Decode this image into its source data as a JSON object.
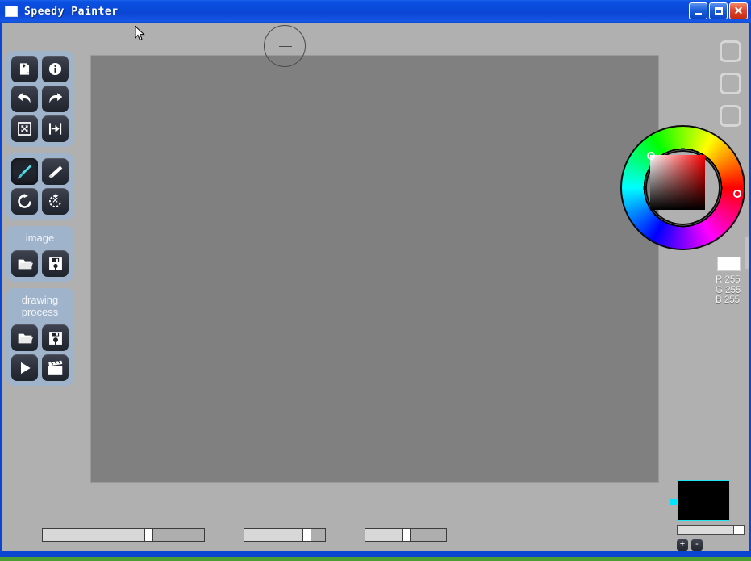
{
  "window": {
    "title": "Speedy Painter",
    "icon": "app-window-icon",
    "buttons": {
      "minimize": "_",
      "maximize": "□",
      "close": "✕"
    }
  },
  "toolbar": {
    "groups": [
      {
        "name": "file-and-view",
        "label": "",
        "buttons": [
          {
            "name": "new-image-button",
            "icon": "new-document-icon",
            "tooltip": "New image"
          },
          {
            "name": "info-button",
            "icon": "info-icon",
            "tooltip": "Info"
          },
          {
            "name": "undo-button",
            "icon": "undo-arrow-icon",
            "tooltip": "Undo"
          },
          {
            "name": "redo-button",
            "icon": "redo-arrow-icon",
            "tooltip": "Redo"
          },
          {
            "name": "fit-screen-button",
            "icon": "fit-to-screen-icon",
            "tooltip": "Fit to screen"
          },
          {
            "name": "fit-width-button",
            "icon": "fit-to-width-icon",
            "tooltip": "Fit width"
          }
        ]
      },
      {
        "name": "drawing-tools",
        "label": "",
        "buttons": [
          {
            "name": "brush-tool-button",
            "icon": "paintbrush-icon",
            "tooltip": "Brush",
            "active": true
          },
          {
            "name": "eraser-tool-button",
            "icon": "eraser-icon",
            "tooltip": "Eraser",
            "active": false
          },
          {
            "name": "rotate-button",
            "icon": "rotate-cw-icon",
            "tooltip": "Rotate canvas"
          },
          {
            "name": "reset-rotate-button",
            "icon": "dashed-rotate-icon",
            "tooltip": "Reset rotation"
          }
        ]
      },
      {
        "name": "image-group",
        "label": "image",
        "buttons": [
          {
            "name": "open-image-button",
            "icon": "folder-open-icon",
            "tooltip": "Open image"
          },
          {
            "name": "save-image-button",
            "icon": "floppy-save-icon",
            "tooltip": "Save image"
          }
        ]
      },
      {
        "name": "drawing-process-group",
        "label": "drawing process",
        "label_line1": "drawing",
        "label_line2": "process",
        "buttons": [
          {
            "name": "open-process-button",
            "icon": "folder-open-icon",
            "tooltip": "Open drawing process"
          },
          {
            "name": "save-process-button",
            "icon": "floppy-gear-icon",
            "tooltip": "Save drawing process"
          },
          {
            "name": "play-process-button",
            "icon": "play-triangle-icon",
            "tooltip": "Play drawing process"
          },
          {
            "name": "export-video-button",
            "icon": "clapperboard-icon",
            "tooltip": "Export video"
          }
        ]
      }
    ]
  },
  "canvas": {
    "name": "drawing-canvas",
    "background_color": "#808080",
    "brush_cursor": {
      "name": "brush-size-cursor",
      "shape": "circle-with-crosshair"
    }
  },
  "right_panel": {
    "square_buttons": [
      {
        "name": "panel-toggle-1",
        "icon": "rounded-square-icon"
      },
      {
        "name": "panel-toggle-2",
        "icon": "rounded-square-icon"
      },
      {
        "name": "panel-toggle-3",
        "icon": "rounded-square-icon"
      }
    ]
  },
  "color_picker": {
    "name": "color-wheel",
    "hue_ring_marker_label": "hue-marker",
    "sv_square_marker_label": "sv-marker",
    "current_color_hex": "#FFFFFF",
    "readout": {
      "r": "R 255",
      "g": "G 255",
      "b": "B 255"
    }
  },
  "layers": {
    "thumbnail_color": "#000000",
    "selection_color": "#22E4EF",
    "opacity_slider_value": 84,
    "add_layer_label": "+",
    "remove_layer_label": "-"
  },
  "bottom_sliders": [
    {
      "name": "brush-size-slider",
      "value_percent": 63
    },
    {
      "name": "brush-opacity-slider",
      "value_percent": 72
    },
    {
      "name": "brush-flow-slider",
      "value_percent": 48
    }
  ]
}
